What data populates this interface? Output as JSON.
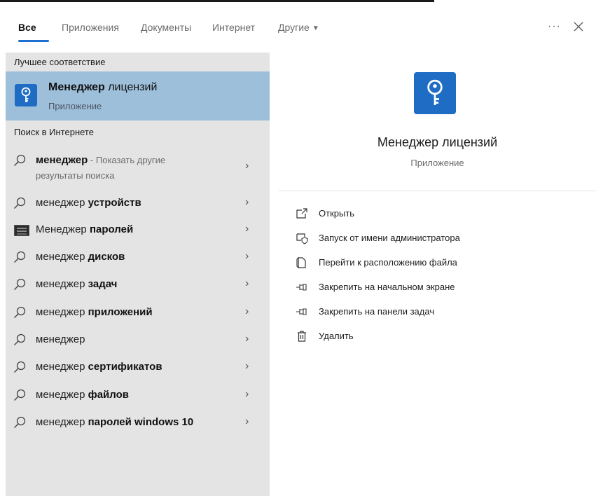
{
  "tabs": {
    "items": [
      {
        "label": "Все",
        "active": true
      },
      {
        "label": "Приложения"
      },
      {
        "label": "Документы"
      },
      {
        "label": "Интернет"
      },
      {
        "label": "Другие"
      }
    ],
    "more_label": "···",
    "close_icon": "close-icon"
  },
  "left": {
    "best_match_title": "Лучшее соответствие",
    "best_match": {
      "title_bold": "Менеджер",
      "title_rest": " лицензий",
      "subtitle": "Приложение",
      "icon": "key-icon"
    },
    "web_title": "Поиск в Интернете",
    "results": [
      {
        "prefix": "менеджер",
        "bold": "",
        "suffix": " - Показать другие",
        "line2": "результаты поиска",
        "icon": "search-icon"
      },
      {
        "prefix": "менеджер ",
        "bold": "устройств",
        "icon": "search-icon"
      },
      {
        "prefix": "Менеджер ",
        "bold": "паролей",
        "icon": "password-manager-icon"
      },
      {
        "prefix": "менеджер ",
        "bold": "дисков",
        "icon": "search-icon"
      },
      {
        "prefix": "менеджер ",
        "bold": "задач",
        "icon": "search-icon"
      },
      {
        "prefix": "менеджер ",
        "bold": "приложений",
        "icon": "search-icon"
      },
      {
        "prefix": "менеджер",
        "bold": "",
        "icon": "search-icon"
      },
      {
        "prefix": "менеджер ",
        "bold": "сертификатов",
        "icon": "search-icon"
      },
      {
        "prefix": "менеджер ",
        "bold": "файлов",
        "icon": "search-icon"
      },
      {
        "prefix": "менеджер ",
        "bold": "паролей windows 10",
        "icon": "search-icon"
      }
    ],
    "chevron": "›"
  },
  "right": {
    "app_title": "Менеджер лицензий",
    "app_subtitle": "Приложение",
    "app_icon": "key-icon",
    "actions": [
      {
        "label": "Открыть",
        "icon": "open-icon"
      },
      {
        "label": "Запуск от имени администратора",
        "icon": "run-as-admin-icon"
      },
      {
        "label": "Перейти к расположению файла",
        "icon": "file-location-icon"
      },
      {
        "label": "Закрепить на начальном экране",
        "icon": "pin-start-icon"
      },
      {
        "label": "Закрепить на панели задач",
        "icon": "pin-taskbar-icon"
      },
      {
        "label": "Удалить",
        "icon": "trash-icon"
      }
    ]
  },
  "colors": {
    "accent": "#1f6fd1",
    "selected_bg": "#9ebfda",
    "left_bg": "#e4e4e4",
    "app_icon_bg": "#1e6cc4"
  }
}
